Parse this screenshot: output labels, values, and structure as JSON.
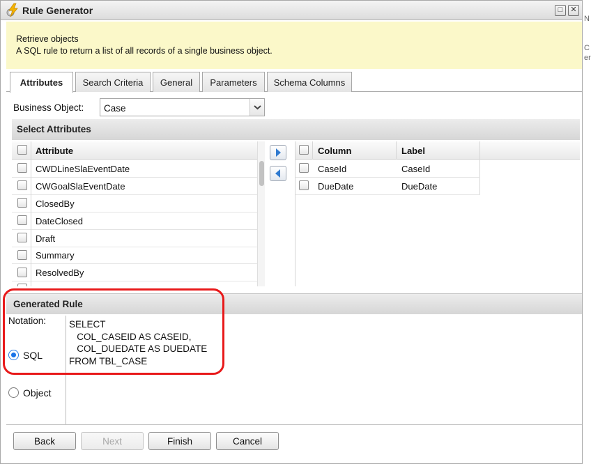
{
  "window": {
    "title": "Rule Generator",
    "maximize_glyph": "□",
    "close_glyph": "✕"
  },
  "description": {
    "title": "Retrieve objects",
    "text": "A SQL rule to return a list of all records of a single business object."
  },
  "tabs": [
    {
      "label": "Attributes",
      "active": true
    },
    {
      "label": "Search Criteria",
      "active": false
    },
    {
      "label": "General",
      "active": false
    },
    {
      "label": "Parameters",
      "active": false
    },
    {
      "label": "Schema Columns",
      "active": false
    }
  ],
  "business_object": {
    "label": "Business Object:",
    "value": "Case"
  },
  "select_attributes": {
    "title": "Select Attributes",
    "available": {
      "header": "Attribute",
      "rows": [
        "CWDLineSlaEventDate",
        "CWGoalSlaEventDate",
        "ClosedBy",
        "DateClosed",
        "Draft",
        "Summary",
        "ResolvedBy"
      ]
    },
    "selected": {
      "headers": [
        "Column",
        "Label"
      ],
      "rows": [
        {
          "column": "CaseId",
          "label": "CaseId"
        },
        {
          "column": "DueDate",
          "label": "DueDate"
        }
      ]
    }
  },
  "generated_rule": {
    "title": "Generated Rule",
    "notation_label": "Notation:",
    "options": [
      {
        "label": "SQL",
        "checked": true
      },
      {
        "label": "Object",
        "checked": false
      }
    ],
    "sql": "SELECT\n   COL_CASEID AS CASEID,\n   COL_DUEDATE AS DUEDATE\nFROM TBL_CASE"
  },
  "buttons": {
    "back": "Back",
    "next": "Next",
    "finish": "Finish",
    "cancel": "Cancel"
  },
  "colors": {
    "description_bg": "#fbf8c9",
    "highlight": "#e8191a",
    "radio_accent": "#1a73e8",
    "arrow_blue": "#2f7ad0"
  },
  "edge_fragments": [
    "N",
    "C",
    "er"
  ]
}
